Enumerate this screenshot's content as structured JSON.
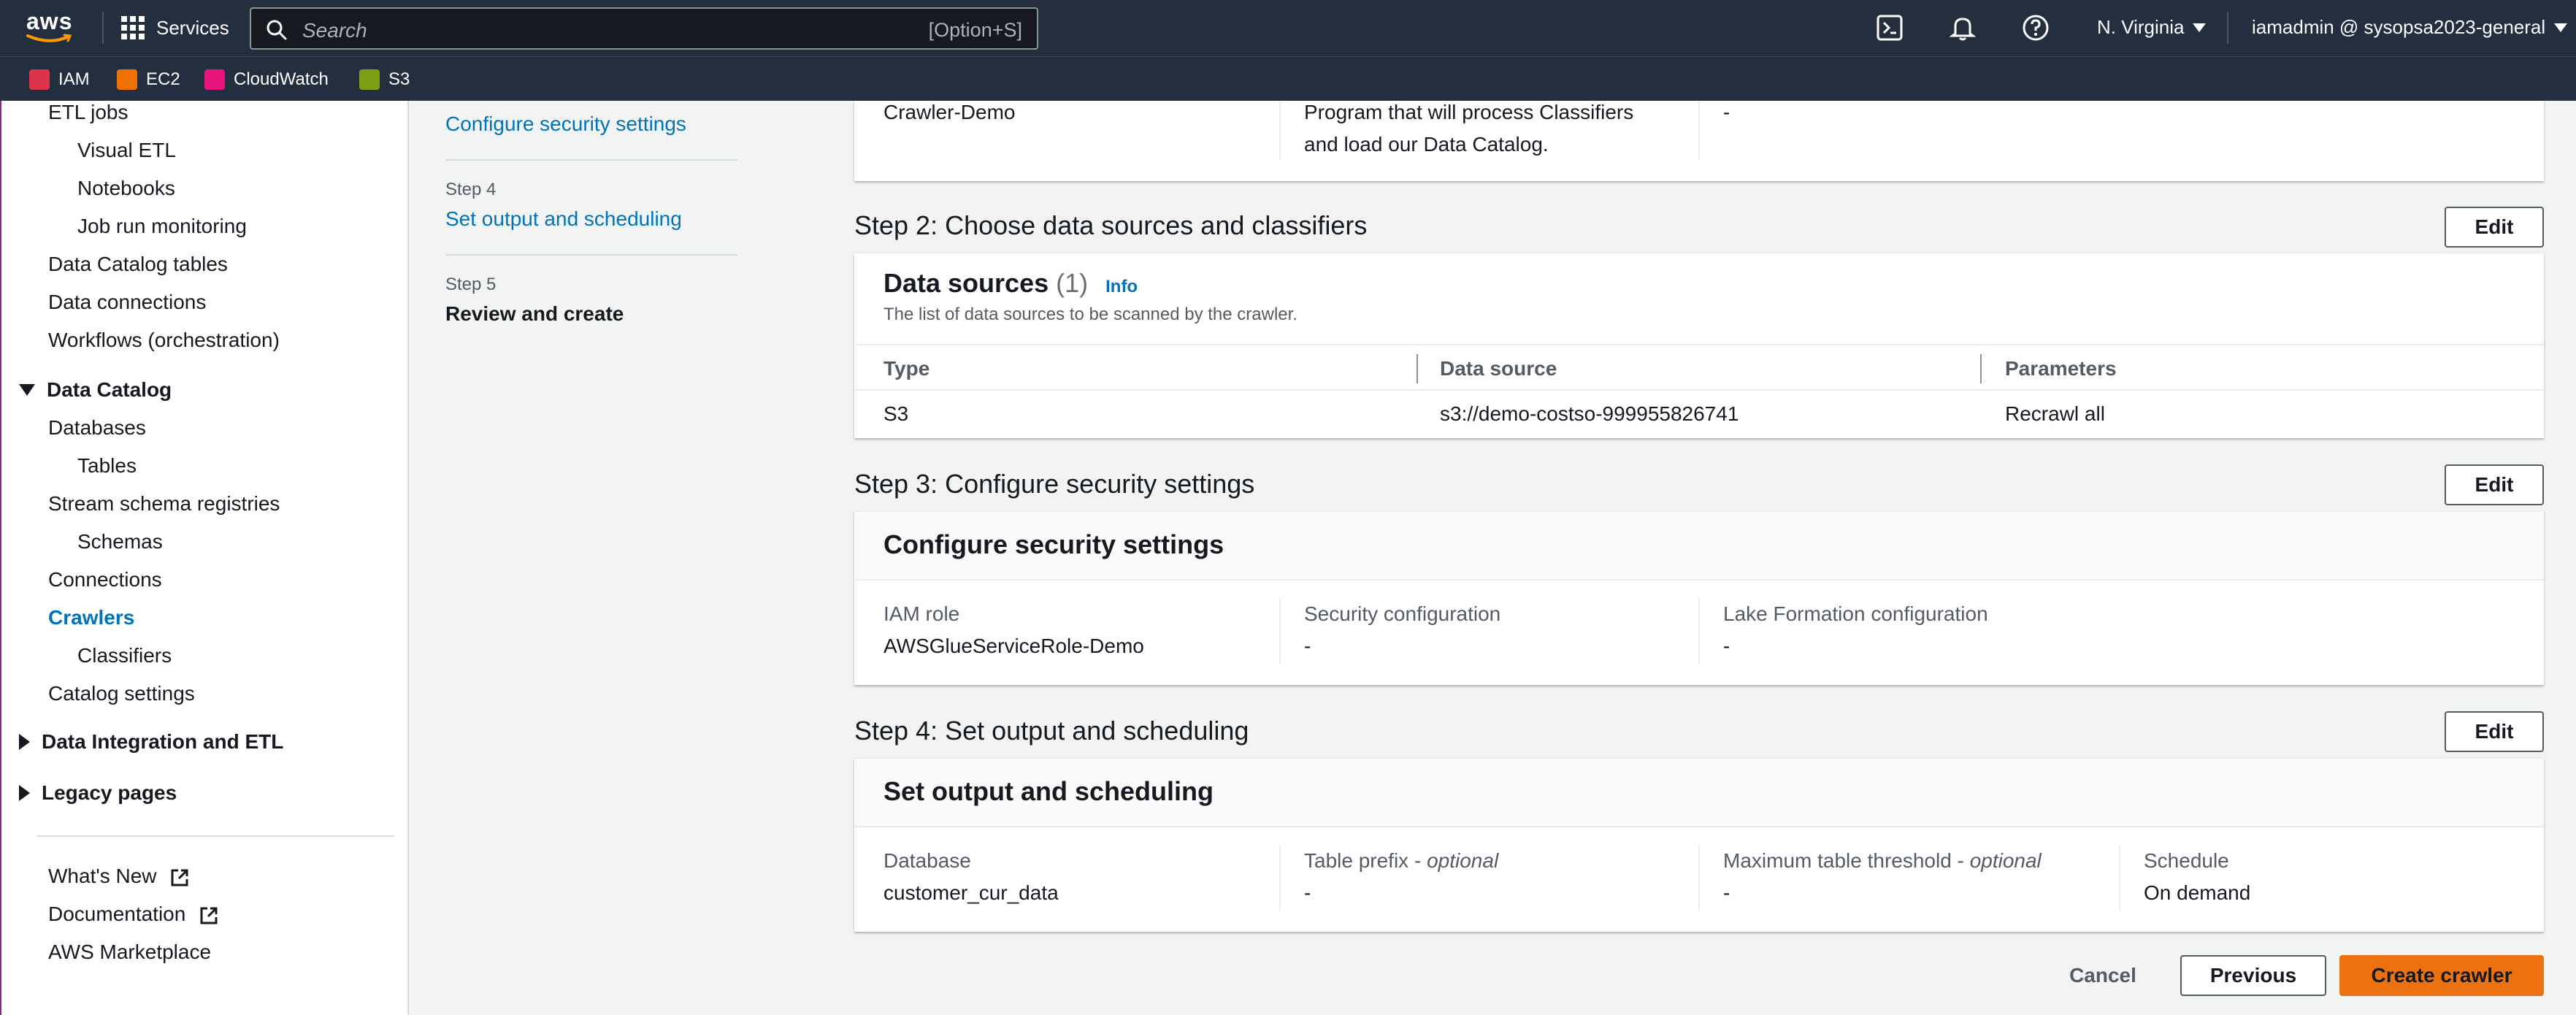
{
  "topbar": {
    "logo_text": "aws",
    "services_label": "Services",
    "search_placeholder": "Search",
    "search_shortcut": "[Option+S]",
    "region": "N. Virginia",
    "account": "iamadmin @ sysopsa2023-general"
  },
  "favorites": [
    {
      "label": "IAM",
      "color": "#dd344c"
    },
    {
      "label": "EC2",
      "color": "#ed7100"
    },
    {
      "label": "CloudWatch",
      "color": "#e7157b"
    },
    {
      "label": "S3",
      "color": "#7aa116"
    }
  ],
  "sidebar": {
    "items": [
      "ETL jobs",
      "Visual ETL",
      "Notebooks",
      "Job run monitoring",
      "Data Catalog tables",
      "Data connections",
      "Workflows (orchestration)"
    ],
    "catalog_section": "Data Catalog",
    "catalog_items": [
      "Databases",
      "Tables",
      "Stream schema registries",
      "Schemas",
      "Connections",
      "Crawlers",
      "Classifiers",
      "Catalog settings"
    ],
    "integration_section": "Data Integration and ETL",
    "legacy_section": "Legacy pages",
    "footer": [
      "What's New",
      "Documentation",
      "AWS Marketplace"
    ]
  },
  "wizard_steps": {
    "step3_link": "Configure security settings",
    "step4_label": "Step 4",
    "step4_link": "Set output and scheduling",
    "step5_label": "Step 5",
    "step5_current": "Review and create"
  },
  "step1_partial": {
    "name_value": "Crawler-Demo",
    "description_line1": "Program that will process Classifiers",
    "description_line2": "and load our Data Catalog.",
    "tags_value": "-"
  },
  "step2": {
    "title": "Step 2: Choose data sources and classifiers",
    "edit": "Edit",
    "panel_title": "Data sources",
    "count": "(1)",
    "info": "Info",
    "description": "The list of data sources to be scanned by the crawler.",
    "columns": [
      "Type",
      "Data source",
      "Parameters"
    ],
    "rows": [
      [
        "S3",
        "s3://demo-costso-999955826741",
        "Recrawl all"
      ]
    ]
  },
  "step3": {
    "title": "Step 3: Configure security settings",
    "edit": "Edit",
    "panel_title": "Configure security settings",
    "fields": [
      {
        "key": "IAM role",
        "value": "AWSGlueServiceRole-Demo"
      },
      {
        "key": "Security configuration",
        "value": "-"
      },
      {
        "key": "Lake Formation configuration",
        "value": "-"
      }
    ]
  },
  "step4": {
    "title": "Step 4: Set output and scheduling",
    "edit": "Edit",
    "panel_title": "Set output and scheduling",
    "optional": "optional",
    "fields": [
      {
        "key": "Database",
        "value": "customer_cur_data"
      },
      {
        "key": "Table prefix - ",
        "value": "-"
      },
      {
        "key": "Maximum table threshold - ",
        "value": "-"
      },
      {
        "key": "Schedule",
        "value": "On demand"
      }
    ]
  },
  "actions": {
    "cancel": "Cancel",
    "previous": "Previous",
    "create": "Create crawler"
  }
}
